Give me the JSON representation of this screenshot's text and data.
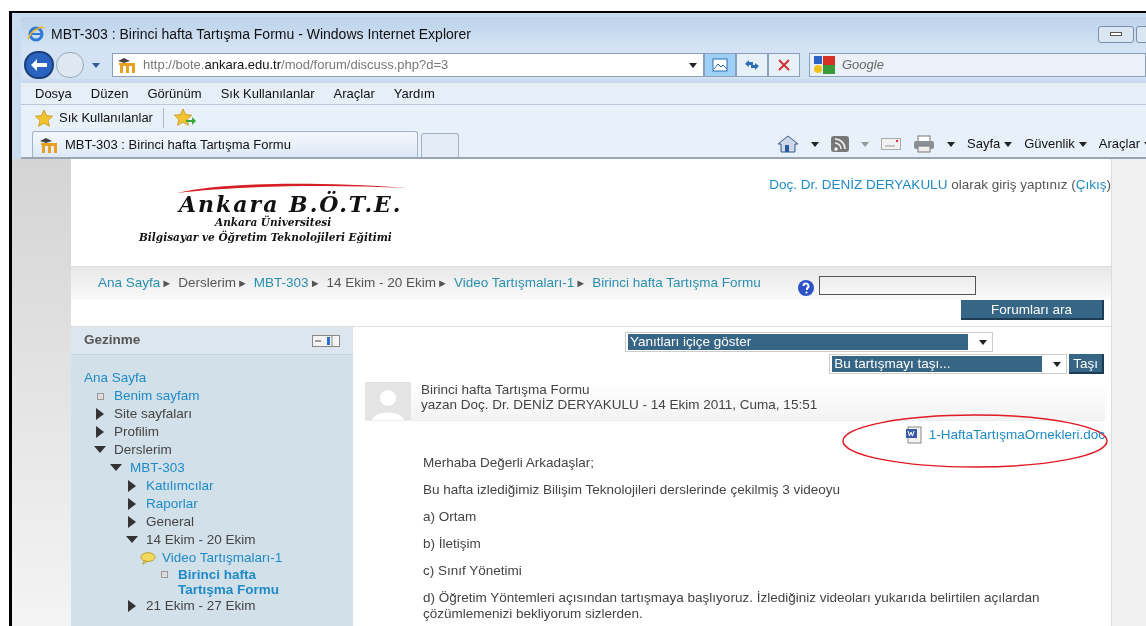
{
  "window": {
    "title": "MBT-303 : Birinci hafta Tartışma Formu - Windows Internet Explorer"
  },
  "address_bar": {
    "url_prefix": "http://bote.",
    "url_domain": "ankara.edu.tr",
    "url_path": "/mod/forum/discuss.php?d=3"
  },
  "search_box": {
    "placeholder": "Google"
  },
  "menu_bar": [
    "Dosya",
    "Düzen",
    "Görünüm",
    "Sık Kullanılanlar",
    "Araçlar",
    "Yardım"
  ],
  "favorites_bar": {
    "label": "Sık Kullanılanlar"
  },
  "tabs": [
    {
      "label": "MBT-303 : Birinci hafta Tartışma Formu",
      "selected": true
    }
  ],
  "command_bar": [
    "Sayfa",
    "Güvenlik",
    "Araçlar"
  ],
  "logo": {
    "title": "Ankara B.Ö.T.E.",
    "subtitle": "Ankara Üniversitesi",
    "tagline": "Bilgisayar ve Öğretim Teknolojileri Eğitimi"
  },
  "login_info": {
    "user": "Doç. Dr. DENİZ DERYAKULU",
    "text": "olarak giriş yaptınız",
    "logout_open": "(",
    "logout": "Çıkış",
    "logout_close": ")"
  },
  "breadcrumb": [
    {
      "label": "Ana Sayfa",
      "link": true,
      "sep": "►"
    },
    {
      "label": "Derslerim",
      "link": false,
      "sep": "►"
    },
    {
      "label": "MBT-303",
      "link": true,
      "sep": "►"
    },
    {
      "label": "14 Ekim - 20 Ekim",
      "link": false,
      "sep": "►"
    },
    {
      "label": "Video Tartışmaları-1",
      "link": true,
      "sep": "►"
    },
    {
      "label": "Birinci hafta Tartışma Formu",
      "link": true
    }
  ],
  "forum_search": {
    "button": "Forumları ara"
  },
  "navigation": {
    "title": "Gezinme",
    "tree": [
      {
        "label": "Ana Sayfa",
        "kind": "root",
        "link": true,
        "current": false,
        "children": [
          {
            "label": "Benim sayfam",
            "kind": "leaf",
            "link": true,
            "current": false
          },
          {
            "label": "Site sayfaları",
            "kind": "branch",
            "expanded": false,
            "link": false,
            "current": false
          },
          {
            "label": "Profilim",
            "kind": "branch",
            "expanded": false,
            "link": false,
            "current": false
          },
          {
            "label": "Derslerim",
            "kind": "branch",
            "expanded": true,
            "link": false,
            "current": false,
            "children": [
              {
                "label": "MBT-303",
                "kind": "branch",
                "expanded": true,
                "link": true,
                "current": false,
                "children": [
                  {
                    "label": "Katılımcılar",
                    "kind": "branch",
                    "expanded": false,
                    "link": true,
                    "current": false
                  },
                  {
                    "label": "Raporlar",
                    "kind": "branch",
                    "expanded": false,
                    "link": true,
                    "current": false
                  },
                  {
                    "label": "General",
                    "kind": "branch",
                    "expanded": false,
                    "link": false,
                    "current": false
                  },
                  {
                    "label": "14 Ekim - 20 Ekim",
                    "kind": "branch",
                    "expanded": true,
                    "link": false,
                    "current": false,
                    "children": [
                      {
                        "label": "Video Tartışmaları-1",
                        "kind": "forum",
                        "link": true,
                        "current": false,
                        "children": [
                          {
                            "label": "Birinci hafta Tartışma Formu",
                            "kind": "leaf",
                            "link": true,
                            "current": true
                          }
                        ]
                      }
                    ]
                  },
                  {
                    "label": "21 Ekim - 27 Ekim",
                    "kind": "branch",
                    "expanded": false,
                    "link": false,
                    "current": false
                  }
                ]
              }
            ]
          }
        ]
      }
    ]
  },
  "display_select": {
    "value": "Yanıtları içiçe göster"
  },
  "move_select": {
    "value": "Bu tartışmayı taşı...",
    "button": "Taşı"
  },
  "post": {
    "subject": "Birinci hafta Tartışma Formu",
    "byline": "yazan Doç. Dr. DENİZ DERYAKULU - 14 Ekim 2011, Cuma, 15:51",
    "attachment": "1-HaftaTartışmaOrnekleri.doc",
    "attachment_highlighted": true,
    "paragraphs": [
      "Merhaba Değerli Arkadaşlar;",
      "Bu hafta izlediğimiz Bilişim Teknolojileri derslerinde çekilmiş 3 videoyu",
      "a) Ortam",
      "b) İletişim",
      "c) Sınıf Yönetimi",
      "d) Öğretim Yöntemleri açısından tartışmaya başlıyoruz. İzlediğiniz videoları yukarıda belirtilen açılardan çözümlemenizi bekliyorum sizlerden."
    ]
  }
}
